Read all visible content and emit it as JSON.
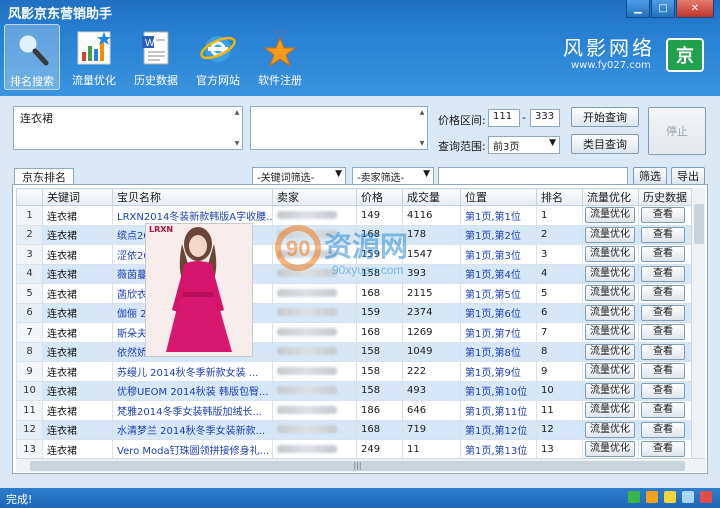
{
  "window": {
    "title": "风影京东营销助手"
  },
  "toolbar": {
    "items": [
      {
        "label": "排名搜索",
        "icon": "magnifier-icon",
        "active": true
      },
      {
        "label": "流量优化",
        "icon": "bar-chart-icon",
        "active": false
      },
      {
        "label": "历史数据",
        "icon": "document-icon",
        "active": false
      },
      {
        "label": "官方网站",
        "icon": "ie-browser-icon",
        "active": false
      },
      {
        "label": "软件注册",
        "icon": "medal-star-icon",
        "active": false
      }
    ]
  },
  "brand": {
    "name": "风影网络",
    "url": "www.fy027.com",
    "logo_text": "京"
  },
  "search": {
    "keyword_value": "连衣裙",
    "price_label": "价格区间:",
    "price_min": "111",
    "price_sep": "-",
    "price_max": "333",
    "range_label": "查询范围:",
    "range_value": "前3页",
    "start_button": "开始查询",
    "category_button": "类目查询",
    "stop_button": "停止"
  },
  "tab": {
    "label": "京东排名"
  },
  "filters": {
    "keyword_filter": "-关键词筛选-",
    "seller_filter": "-卖家筛选-",
    "filter_button": "筛选",
    "export_button": "导出"
  },
  "table": {
    "columns": [
      "",
      "关键词",
      "宝贝名称",
      "卖家",
      "价格",
      "成交量",
      "位置",
      "排名",
      "流量优化",
      "历史数据"
    ],
    "optimize_label": "流量优化",
    "view_label": "查看",
    "rows": [
      {
        "idx": "1",
        "kw": "连衣裙",
        "name": "LRXN2014冬装新款韩版A字收腰...",
        "price": "149",
        "sales": "4116",
        "pos": "第1页,第1位",
        "rank": "1"
      },
      {
        "idx": "2",
        "kw": "连衣裙",
        "name": "缤点20",
        "price": "168",
        "sales": "178",
        "pos": "第1页,第2位",
        "rank": "2"
      },
      {
        "idx": "3",
        "kw": "连衣裙",
        "name": "涩依20",
        "price": "159",
        "sales": "1547",
        "pos": "第1页,第3位",
        "rank": "3"
      },
      {
        "idx": "4",
        "kw": "连衣裙",
        "name": "薇茵蔓",
        "price": "158",
        "sales": "393",
        "pos": "第1页,第4位",
        "rank": "4"
      },
      {
        "idx": "5",
        "kw": "连衣裙",
        "name": "菡欣衣",
        "price": "168",
        "sales": "2115",
        "pos": "第1页,第5位",
        "rank": "5"
      },
      {
        "idx": "6",
        "kw": "连衣裙",
        "name": "伽俪 2",
        "price": "159",
        "sales": "2374",
        "pos": "第1页,第6位",
        "rank": "6"
      },
      {
        "idx": "7",
        "kw": "连衣裙",
        "name": "斯朵夫",
        "price": "168",
        "sales": "1269",
        "pos": "第1页,第7位",
        "rank": "7"
      },
      {
        "idx": "8",
        "kw": "连衣裙",
        "name": "依然娇",
        "price": "158",
        "sales": "1049",
        "pos": "第1页,第8位",
        "rank": "8"
      },
      {
        "idx": "9",
        "kw": "连衣裙",
        "name": "苏缦儿 2014秋冬季新款女装 ...",
        "price": "158",
        "sales": "222",
        "pos": "第1页,第9位",
        "rank": "9"
      },
      {
        "idx": "10",
        "kw": "连衣裙",
        "name": "优穆UEOM 2014秋装 韩版包臀...",
        "price": "158",
        "sales": "493",
        "pos": "第1页,第10位",
        "rank": "10"
      },
      {
        "idx": "11",
        "kw": "连衣裙",
        "name": "梵雅2014冬季女装韩版加绒长...",
        "price": "186",
        "sales": "646",
        "pos": "第1页,第11位",
        "rank": "11"
      },
      {
        "idx": "12",
        "kw": "连衣裙",
        "name": "水清梦兰 2014秋冬季女装新款...",
        "price": "168",
        "sales": "719",
        "pos": "第1页,第12位",
        "rank": "12"
      },
      {
        "idx": "13",
        "kw": "连衣裙",
        "name": "Vero Moda钉珠圆领拼接修身礼...",
        "price": "249",
        "sales": "11",
        "pos": "第1页,第13位",
        "rank": "13"
      }
    ]
  },
  "popup": {
    "label": "LRXN"
  },
  "watermark": {
    "text_main": "资源网",
    "text_url": "90xyuan.com"
  },
  "status": {
    "text": "完成!"
  },
  "colors": {
    "header": "#2a84d6",
    "link": "#1c3fb8",
    "logo": "#21a14b"
  }
}
